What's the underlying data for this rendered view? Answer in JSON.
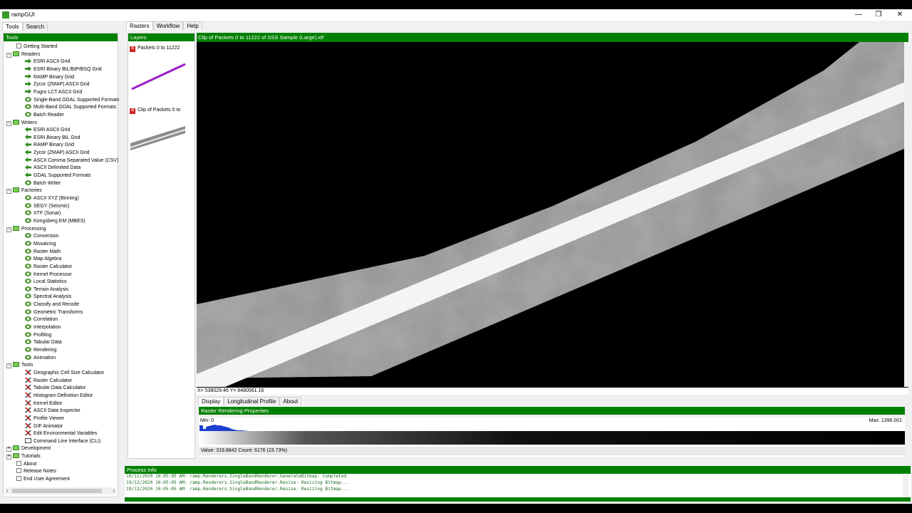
{
  "window": {
    "title": "rampGUI",
    "minimize": "—",
    "restore": "❐",
    "close": "✕"
  },
  "left_tabs": [
    "Tools",
    "Search"
  ],
  "tools_header": "Tools",
  "tree": [
    {
      "label": "Getting Started",
      "indent": 1,
      "icon": "doc"
    },
    {
      "label": "Readers",
      "indent": 0,
      "icon": "folder",
      "exp": "−"
    },
    {
      "label": "ESRI ASCII Grid",
      "indent": 2,
      "icon": "reader"
    },
    {
      "label": "ESRI Binary BIL/BIP/BSQ Grid",
      "indent": 2,
      "icon": "reader"
    },
    {
      "label": "RAMP Binary Grid",
      "indent": 2,
      "icon": "reader"
    },
    {
      "label": "Zycor (ZMAP) ASCII Grid",
      "indent": 2,
      "icon": "reader"
    },
    {
      "label": "Fugro LCT ASCII Grid",
      "indent": 2,
      "icon": "reader"
    },
    {
      "label": "Single-Band GDAL Supported Formats",
      "indent": 2,
      "icon": "gear"
    },
    {
      "label": "Multi-Band GDAL Supported Formats",
      "indent": 2,
      "icon": "gear"
    },
    {
      "label": "Batch Reader",
      "indent": 2,
      "icon": "gear"
    },
    {
      "label": "Writers",
      "indent": 0,
      "icon": "folder",
      "exp": "−"
    },
    {
      "label": "ESRI ASCII Grid",
      "indent": 2,
      "icon": "writer"
    },
    {
      "label": "ESRI Binary BIL Grid",
      "indent": 2,
      "icon": "writer"
    },
    {
      "label": "RAMP Binary Grid",
      "indent": 2,
      "icon": "writer"
    },
    {
      "label": "Zycor (ZMAP) ASCII Grid",
      "indent": 2,
      "icon": "writer"
    },
    {
      "label": "ASCII Comma Separated Value (CSV)",
      "indent": 2,
      "icon": "writer"
    },
    {
      "label": "ASCII Delimited Data",
      "indent": 2,
      "icon": "writer"
    },
    {
      "label": "GDAL Supported Formats",
      "indent": 2,
      "icon": "writer"
    },
    {
      "label": "Batch Writer",
      "indent": 2,
      "icon": "gear"
    },
    {
      "label": "Factories",
      "indent": 0,
      "icon": "folder",
      "exp": "−"
    },
    {
      "label": "ASCII XYZ (Binning)",
      "indent": 2,
      "icon": "gear"
    },
    {
      "label": "SEGY (Seismic)",
      "indent": 2,
      "icon": "gear"
    },
    {
      "label": "XTF (Sonar)",
      "indent": 2,
      "icon": "gear"
    },
    {
      "label": "Kongsberg EM (MBES)",
      "indent": 2,
      "icon": "gear"
    },
    {
      "label": "Processing",
      "indent": 0,
      "icon": "folder",
      "exp": "−"
    },
    {
      "label": "Conversion",
      "indent": 2,
      "icon": "gear"
    },
    {
      "label": "Mosaicing",
      "indent": 2,
      "icon": "gear"
    },
    {
      "label": "Raster Math",
      "indent": 2,
      "icon": "gear"
    },
    {
      "label": "Map Algebra",
      "indent": 2,
      "icon": "gear"
    },
    {
      "label": "Raster Calculator",
      "indent": 2,
      "icon": "gear"
    },
    {
      "label": "Kernel Processor",
      "indent": 2,
      "icon": "gear"
    },
    {
      "label": "Local Statistics",
      "indent": 2,
      "icon": "gear"
    },
    {
      "label": "Terrain Analysis",
      "indent": 2,
      "icon": "gear"
    },
    {
      "label": "Spectral Analysis",
      "indent": 2,
      "icon": "gear"
    },
    {
      "label": "Classify and Recode",
      "indent": 2,
      "icon": "gear"
    },
    {
      "label": "Geometric Transforms",
      "indent": 2,
      "icon": "gear"
    },
    {
      "label": "Correlation",
      "indent": 2,
      "icon": "gear"
    },
    {
      "label": "Interpolation",
      "indent": 2,
      "icon": "gear"
    },
    {
      "label": "Profiling",
      "indent": 2,
      "icon": "gear"
    },
    {
      "label": "Tabular Data",
      "indent": 2,
      "icon": "gear"
    },
    {
      "label": "Rendering",
      "indent": 2,
      "icon": "gear"
    },
    {
      "label": "Animation",
      "indent": 2,
      "icon": "gear"
    },
    {
      "label": "Tools",
      "indent": 0,
      "icon": "folder",
      "exp": "−"
    },
    {
      "label": "Geographic Cell Size Calculator",
      "indent": 2,
      "icon": "tool"
    },
    {
      "label": "Raster Calculator",
      "indent": 2,
      "icon": "tool"
    },
    {
      "label": "Tabular Data Calculator",
      "indent": 2,
      "icon": "tool"
    },
    {
      "label": "Histogram Definition Editor",
      "indent": 2,
      "icon": "tool"
    },
    {
      "label": "Kernel Editor",
      "indent": 2,
      "icon": "tool"
    },
    {
      "label": "ASCII Data Inspector",
      "indent": 2,
      "icon": "tool"
    },
    {
      "label": "Profile Viewer",
      "indent": 2,
      "icon": "tool"
    },
    {
      "label": "GIF Animator",
      "indent": 2,
      "icon": "tool"
    },
    {
      "label": "Edit Environmental Variables",
      "indent": 2,
      "icon": "tool"
    },
    {
      "label": "Command Line Interface (CLI)",
      "indent": 2,
      "icon": "cli"
    },
    {
      "label": "Development",
      "indent": 0,
      "icon": "folder",
      "exp": "+"
    },
    {
      "label": "Tutorials",
      "indent": 0,
      "icon": "folder",
      "exp": "+"
    },
    {
      "label": "About",
      "indent": 1,
      "icon": "doc"
    },
    {
      "label": "Release Notes",
      "indent": 1,
      "icon": "doc"
    },
    {
      "label": "End User Agreement",
      "indent": 1,
      "icon": "doc"
    }
  ],
  "main_tabs": [
    "Rasters",
    "Workflow",
    "Help"
  ],
  "layers": {
    "header": "Layers",
    "items": [
      {
        "name": "Packets 0 to 11222",
        "checked": "✕"
      },
      {
        "name": "Clip of Packets 0 to",
        "checked": "✕"
      }
    ]
  },
  "map": {
    "title": "Clip of Packets 0 to 11222 of SSS Sample (Large).xtf",
    "coords": "X= 538029.46  Y= 8480561.16"
  },
  "props": {
    "tabs": [
      "Display",
      "Longitudinal Profile",
      "About"
    ],
    "header": "Raster Rendering Properties",
    "min_label": "Min: 0",
    "max_label": "Max: 1396.001",
    "status": "Value: 319.8842  Count: 6176 (23.73%)"
  },
  "process": {
    "header": "Process Info",
    "lines": [
      "19/12/2020 10:05:05 AM: ramp.Renderers.SingleBandRenderer.GenerateBitmap: Completed",
      "19/12/2020 10:05:05 AM: ramp.Renderers.SingleBandRenderer.Resize: Resizing Bitmap...",
      "19/12/2020 10:05:05 AM: ramp.Renderers.SingleBandRenderer.Resize: Resizing Bitmap..."
    ]
  },
  "colors": {
    "accent_green": "#008000",
    "layer_line": "#9b1fc9"
  }
}
